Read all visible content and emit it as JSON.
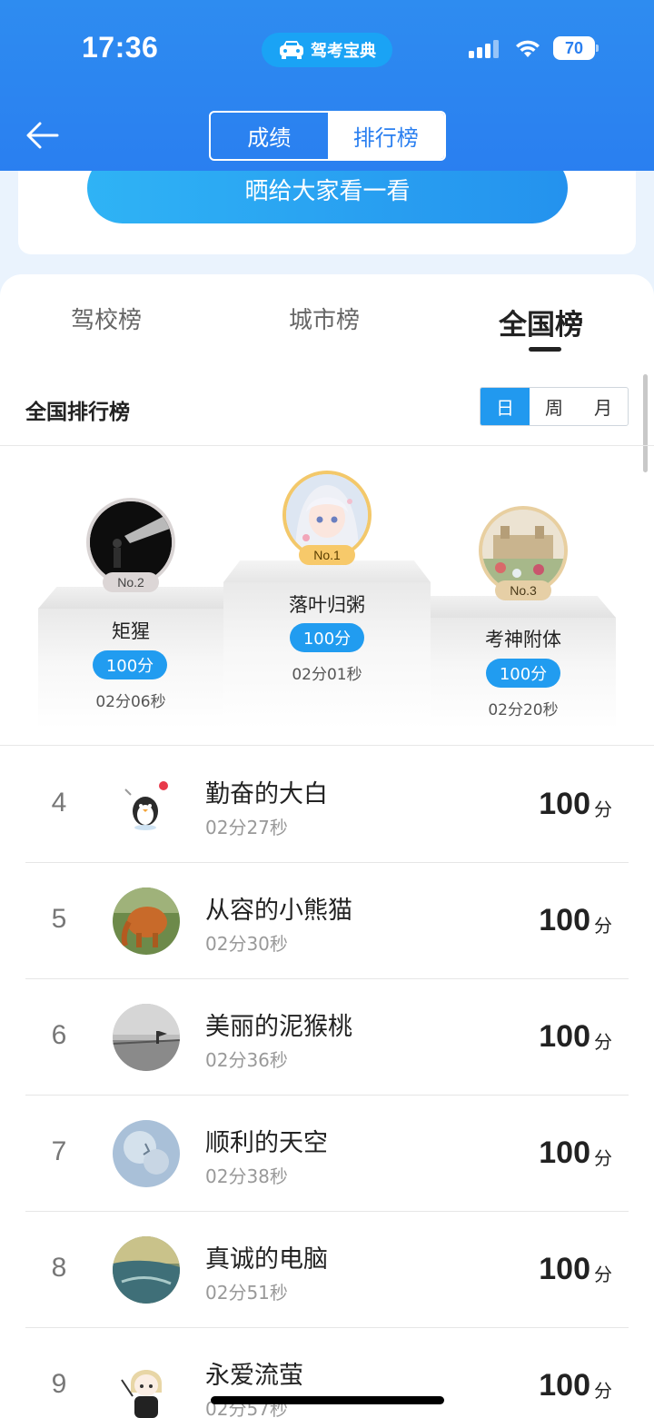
{
  "status_bar": {
    "time": "17:36",
    "app_badge": "驾考宝典",
    "battery": "70"
  },
  "header": {
    "segments": [
      {
        "label": "成绩",
        "active": false
      },
      {
        "label": "排行榜",
        "active": true
      }
    ]
  },
  "share": {
    "label": "晒给大家看一看"
  },
  "tabs": [
    {
      "label": "驾校榜",
      "active": false
    },
    {
      "label": "城市榜",
      "active": false
    },
    {
      "label": "全国榜",
      "active": true
    }
  ],
  "board": {
    "title": "全国排行榜",
    "periods": [
      {
        "label": "日",
        "active": true
      },
      {
        "label": "周",
        "active": false
      },
      {
        "label": "月",
        "active": false
      }
    ]
  },
  "podium": [
    {
      "rank_label": "No.1",
      "name": "落叶归粥",
      "score": "100分",
      "time": "02分01秒"
    },
    {
      "rank_label": "No.2",
      "name": "矩猩",
      "score": "100分",
      "time": "02分06秒"
    },
    {
      "rank_label": "No.3",
      "name": "考神附体",
      "score": "100分",
      "time": "02分20秒"
    }
  ],
  "list": [
    {
      "rank": "4",
      "name": "勤奋的大白",
      "time": "02分27秒",
      "score": "100",
      "unit": "分"
    },
    {
      "rank": "5",
      "name": "从容的小熊猫",
      "time": "02分30秒",
      "score": "100",
      "unit": "分"
    },
    {
      "rank": "6",
      "name": "美丽的泥猴桃",
      "time": "02分36秒",
      "score": "100",
      "unit": "分"
    },
    {
      "rank": "7",
      "name": "顺利的天空",
      "time": "02分38秒",
      "score": "100",
      "unit": "分"
    },
    {
      "rank": "8",
      "name": "真诚的电脑",
      "time": "02分51秒",
      "score": "100",
      "unit": "分"
    },
    {
      "rank": "9",
      "name": "永爱流萤",
      "time": "02分57秒",
      "score": "100",
      "unit": "分"
    }
  ],
  "colors": {
    "header_blue": "#2a7ff0",
    "accent_blue": "#219cf0",
    "gold": "#f7c96a",
    "silver": "#d9d4d4",
    "bronze": "#e8cfa0"
  }
}
